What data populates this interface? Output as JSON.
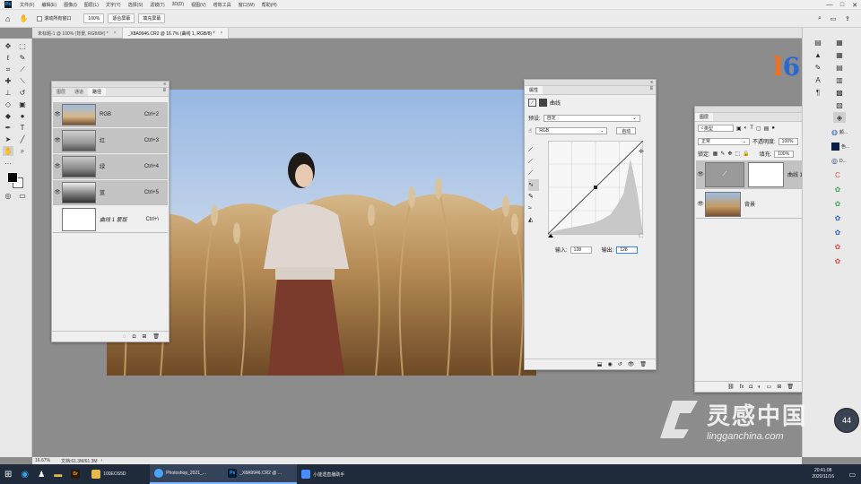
{
  "menu": {
    "logo": "Ps",
    "items": [
      "文件(F)",
      "编辑(E)",
      "图像(I)",
      "图层(L)",
      "文字(Y)",
      "选择(S)",
      "滤镜(T)",
      "3D(D)",
      "视图(V)",
      "增效工具",
      "窗口(W)",
      "帮助(H)"
    ],
    "window_controls": [
      "—",
      "□",
      "✕"
    ]
  },
  "options": {
    "scroll_all": "滚动所有窗口",
    "zoom": "100%",
    "fit_screen": "适合屏幕",
    "fill_screen": "填充屏幕"
  },
  "tabs": [
    {
      "label": "未标题-1 @ 100% (背景, RGB/8#) *",
      "active": false
    },
    {
      "label": "_X8A9946.CR2 @ 16.7% (曲线 1, RGB/8) *",
      "active": true
    }
  ],
  "channels_panel": {
    "tabs": [
      "图层",
      "通道",
      "路径"
    ],
    "rows": [
      {
        "name": "RGB",
        "shortcut": "Ctrl+2"
      },
      {
        "name": "红",
        "shortcut": "Ctrl+3"
      },
      {
        "name": "绿",
        "shortcut": "Ctrl+4"
      },
      {
        "name": "蓝",
        "shortcut": "Ctrl+5"
      },
      {
        "name": "曲线 1 蒙版",
        "shortcut": "Ctrl+\\"
      }
    ]
  },
  "properties_panel": {
    "tab": "属性",
    "title": "曲线",
    "preset_label": "预设:",
    "preset_value": "自定",
    "channel_value": "RGB",
    "auto": "自动",
    "input_label": "输入:",
    "input_value": "128",
    "output_label": "输出:",
    "output_value": "128"
  },
  "layers_panel": {
    "tab": "图层",
    "filter": "类型",
    "blend_mode": "正常",
    "opacity_label": "不透明度:",
    "opacity_value": "100%",
    "lock_label": "锁定:",
    "fill_label": "填充:",
    "fill_value": "100%",
    "layers": [
      {
        "name": "曲线 1"
      },
      {
        "name": "背景"
      }
    ]
  },
  "rightstrip_labels": [
    "颜...",
    "色...",
    "D..."
  ],
  "status": {
    "zoom": "16.67%",
    "doc": "文档:61.3M/61.3M"
  },
  "watermark": {
    "cn": "灵感中国",
    "url": "lingganchina.com",
    "badge": "44"
  },
  "taskbar": {
    "items": [
      {
        "label": "100EOS5D",
        "color": "#e8b84a"
      },
      {
        "label": "Photoshop_2021_...",
        "color": "#4aa3ff"
      },
      {
        "label": "_X8A9946.CR2 @ ...",
        "color": "#31a8ff"
      },
      {
        "label": "小能遗直播助手",
        "color": "#4a8cff"
      }
    ],
    "time": "20:41:08",
    "date": "2020/11/16"
  }
}
